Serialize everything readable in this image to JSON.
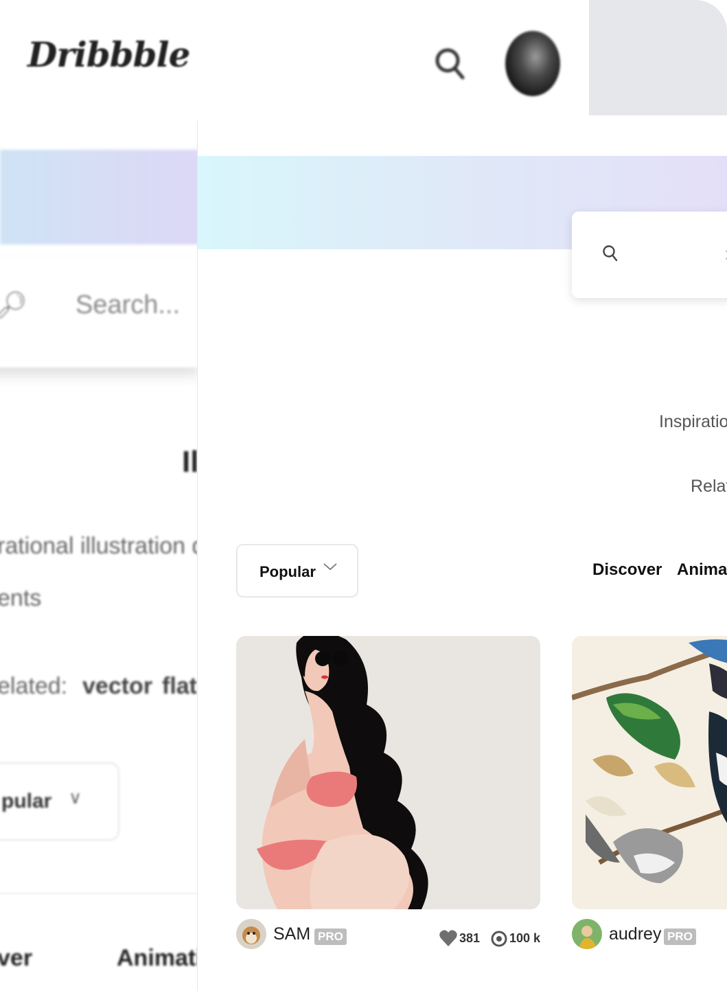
{
  "background": {
    "logo": "Dribbble",
    "search_placeholder": "Search...",
    "title_fragment": "Il",
    "description_line1": "rational illustration de",
    "description_line2": "ents",
    "related_label": "elated:",
    "related_tags": [
      "vector",
      "flat"
    ],
    "sort_label": "pular",
    "nav": [
      "ver",
      "Animatio"
    ]
  },
  "front": {
    "inspiration_fragment": "Inspiration",
    "related_fragment": "Relat",
    "sort_label": "Popular",
    "nav": [
      "Discover",
      "Animat"
    ],
    "shots": [
      {
        "author": "SAM",
        "badge": "PRO",
        "likes": "381",
        "views": "100 k"
      },
      {
        "author": "audrey",
        "badge": "PRO"
      }
    ]
  },
  "colors": {
    "gradient_start": "#d8f6fb",
    "gradient_end": "#e4dff8",
    "pro_badge": "#bdbdbd",
    "panel_grey": "#e5e7eb"
  },
  "icons": [
    "search-icon",
    "chevron-down-icon",
    "heart-icon",
    "eye-icon",
    "avatar"
  ]
}
